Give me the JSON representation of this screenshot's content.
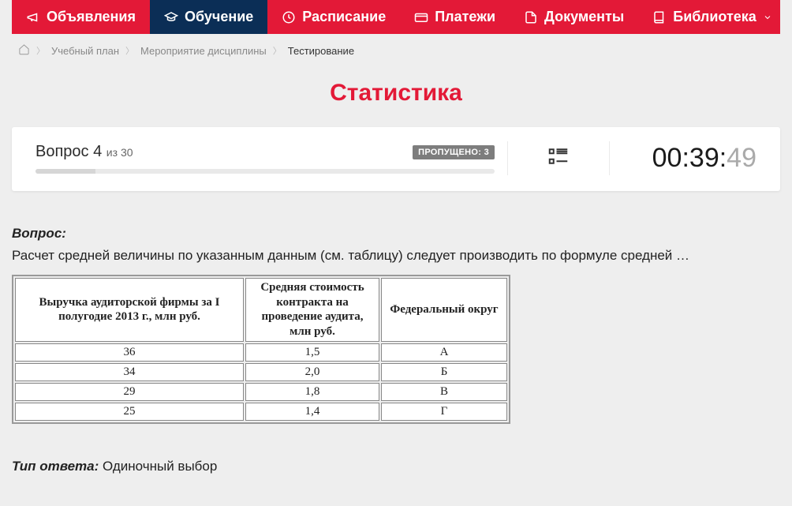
{
  "nav": {
    "items": [
      {
        "label": "Объявления",
        "active": false
      },
      {
        "label": "Обучение",
        "active": true
      },
      {
        "label": "Расписание",
        "active": false
      },
      {
        "label": "Платежи",
        "active": false
      },
      {
        "label": "Документы",
        "active": false
      },
      {
        "label": "Библиотека",
        "active": false,
        "dropdown": true
      }
    ]
  },
  "breadcrumb": {
    "items": [
      "Учебный план",
      "Мероприятие дисциплины",
      "Тестирование"
    ]
  },
  "page_title": "Статистика",
  "status": {
    "question_prefix": "Вопрос",
    "question_num": "4",
    "of_prefix": "из",
    "question_total": "30",
    "skipped_badge": "ПРОПУЩЕНО: 3",
    "progress_pct": 13,
    "timer_main": "00:39:",
    "timer_secs": "49"
  },
  "question": {
    "label": "Вопрос:",
    "text": "Расчет средней величины по указанным данным (см. таблицу) следует производить по формуле средней …",
    "answer_type_label": "Тип ответа:",
    "answer_type_value": "Одиночный выбор",
    "table": {
      "headers": [
        "Выручка аудиторской фирмы за I полугодие 2013 г., млн руб.",
        "Средняя стоимость контракта на проведение аудита, млн руб.",
        "Федеральный округ"
      ],
      "rows": [
        [
          "36",
          "1,5",
          "А"
        ],
        [
          "34",
          "2,0",
          "Б"
        ],
        [
          "29",
          "1,8",
          "В"
        ],
        [
          "25",
          "1,4",
          "Г"
        ]
      ]
    }
  }
}
